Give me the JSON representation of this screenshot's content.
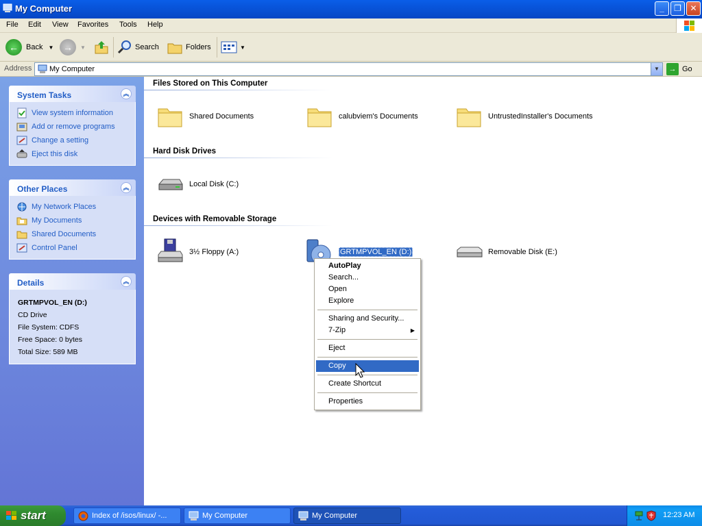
{
  "window": {
    "title": "My Computer",
    "buttons": [
      "minimize-icon",
      "maximize-icon",
      "close-icon"
    ]
  },
  "menu": [
    "File",
    "Edit",
    "View",
    "Favorites",
    "Tools",
    "Help"
  ],
  "toolbar": {
    "back": "Back",
    "search": "Search",
    "folders": "Folders"
  },
  "address": {
    "label": "Address",
    "value": "My Computer",
    "go": "Go"
  },
  "sidebar": {
    "system_tasks": {
      "title": "System Tasks",
      "items": [
        "View system information",
        "Add or remove programs",
        "Change a setting",
        "Eject this disk"
      ]
    },
    "other_places": {
      "title": "Other Places",
      "items": [
        "My Network Places",
        "My Documents",
        "Shared Documents",
        "Control Panel"
      ]
    },
    "details": {
      "title": "Details",
      "name": "GRTMPVOL_EN (D:)",
      "type": "CD Drive",
      "fs": "File System: CDFS",
      "free": "Free Space: 0 bytes",
      "total": "Total Size: 589 MB"
    }
  },
  "groups": {
    "files": {
      "title": "Files Stored on This Computer",
      "items": [
        "Shared Documents",
        "calubviem's Documents",
        "UntrustedInstaller's Documents"
      ]
    },
    "hdd": {
      "title": "Hard Disk Drives",
      "items": [
        "Local Disk (C:)"
      ]
    },
    "removable": {
      "title": "Devices with Removable Storage",
      "items": [
        "3½ Floppy (A:)",
        "GRTMPVOL_EN (D:)",
        "Removable Disk (E:)"
      ]
    }
  },
  "context_menu": {
    "items": [
      "AutoPlay",
      "Search...",
      "Open",
      "Explore",
      "Sharing and Security...",
      "7-Zip",
      "Eject",
      "Copy",
      "Create Shortcut",
      "Properties"
    ],
    "highlighted": "Copy"
  },
  "taskbar": {
    "start": "start",
    "tasks": [
      "Index of /isos/linux/ -...",
      "My Computer",
      "My Computer"
    ],
    "clock": "12:23 AM"
  },
  "colors": {
    "title_blue": "#0a5ee8",
    "selection": "#316ac5",
    "link": "#215dc6",
    "start_green": "#2f8a2f"
  }
}
